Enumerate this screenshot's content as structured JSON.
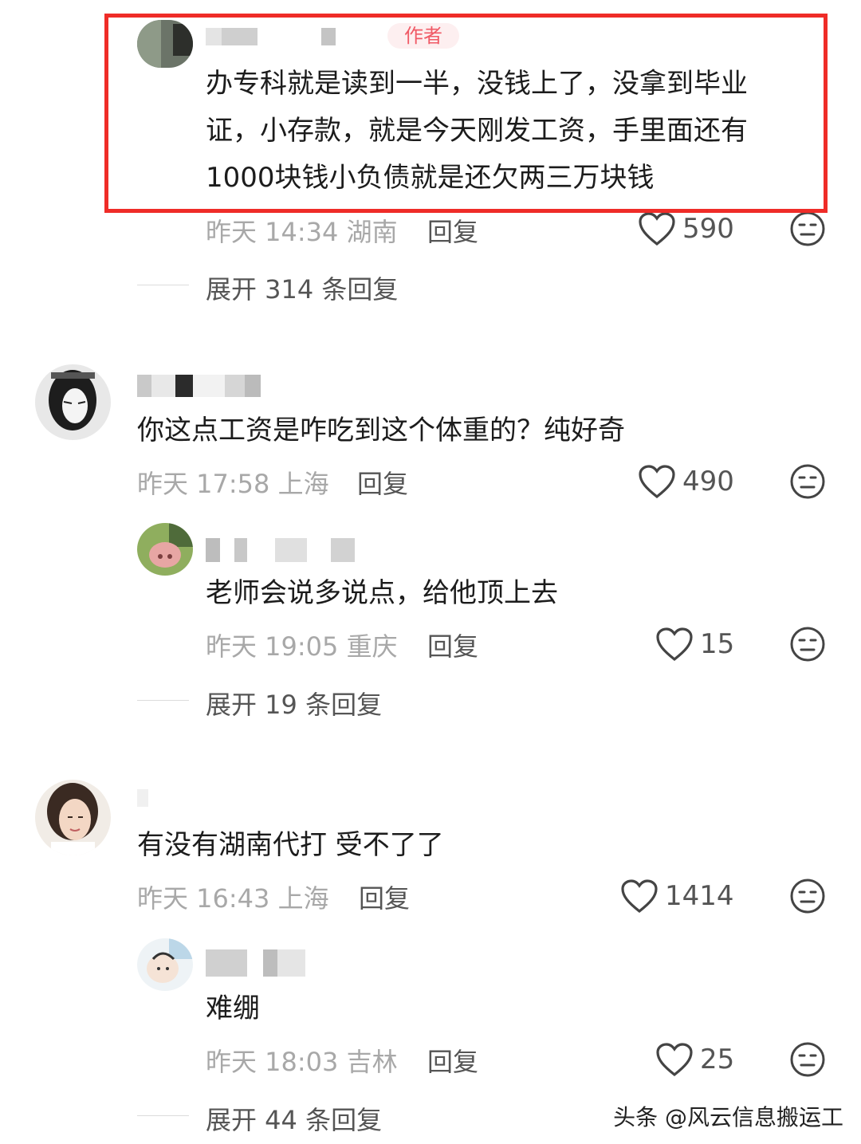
{
  "comments": [
    {
      "badge": "作者",
      "text_lines": [
        "办专科就是读到一半，没钱上了，没拿到毕业",
        "证，小存款，就是今天刚发工资，手里面还有",
        "1000块钱小负债就是还欠两三万块钱"
      ],
      "time": "昨天 14:34 湖南",
      "reply_label": "回复",
      "likes": "590",
      "expand_label": "展开 314 条回复"
    },
    {
      "text_lines": [
        "你这点工资是咋吃到这个体重的？纯好奇"
      ],
      "time": "昨天 17:58 上海",
      "reply_label": "回复",
      "likes": "490"
    },
    {
      "text_lines": [
        "老师会说多说点，给他顶上去"
      ],
      "time": "昨天 19:05 重庆",
      "reply_label": "回复",
      "likes": "15",
      "expand_label": "展开 19 条回复"
    },
    {
      "text_lines": [
        "有没有湖南代打 受不了了"
      ],
      "time": "昨天 16:43 上海",
      "reply_label": "回复",
      "likes": "1414"
    },
    {
      "text_lines": [
        "难绷"
      ],
      "time": "昨天 18:03 吉林",
      "reply_label": "回复",
      "likes": "25",
      "expand_label": "展开 44 条回复"
    }
  ],
  "watermark": "头条 @风云信息搬运工",
  "colors": {
    "highlight": "#ef2c28",
    "badge_text": "#f05a66",
    "meta": "#a8a8a8"
  },
  "icons": {
    "like": "heart-outline-icon",
    "dislike": "meh-face-icon"
  }
}
